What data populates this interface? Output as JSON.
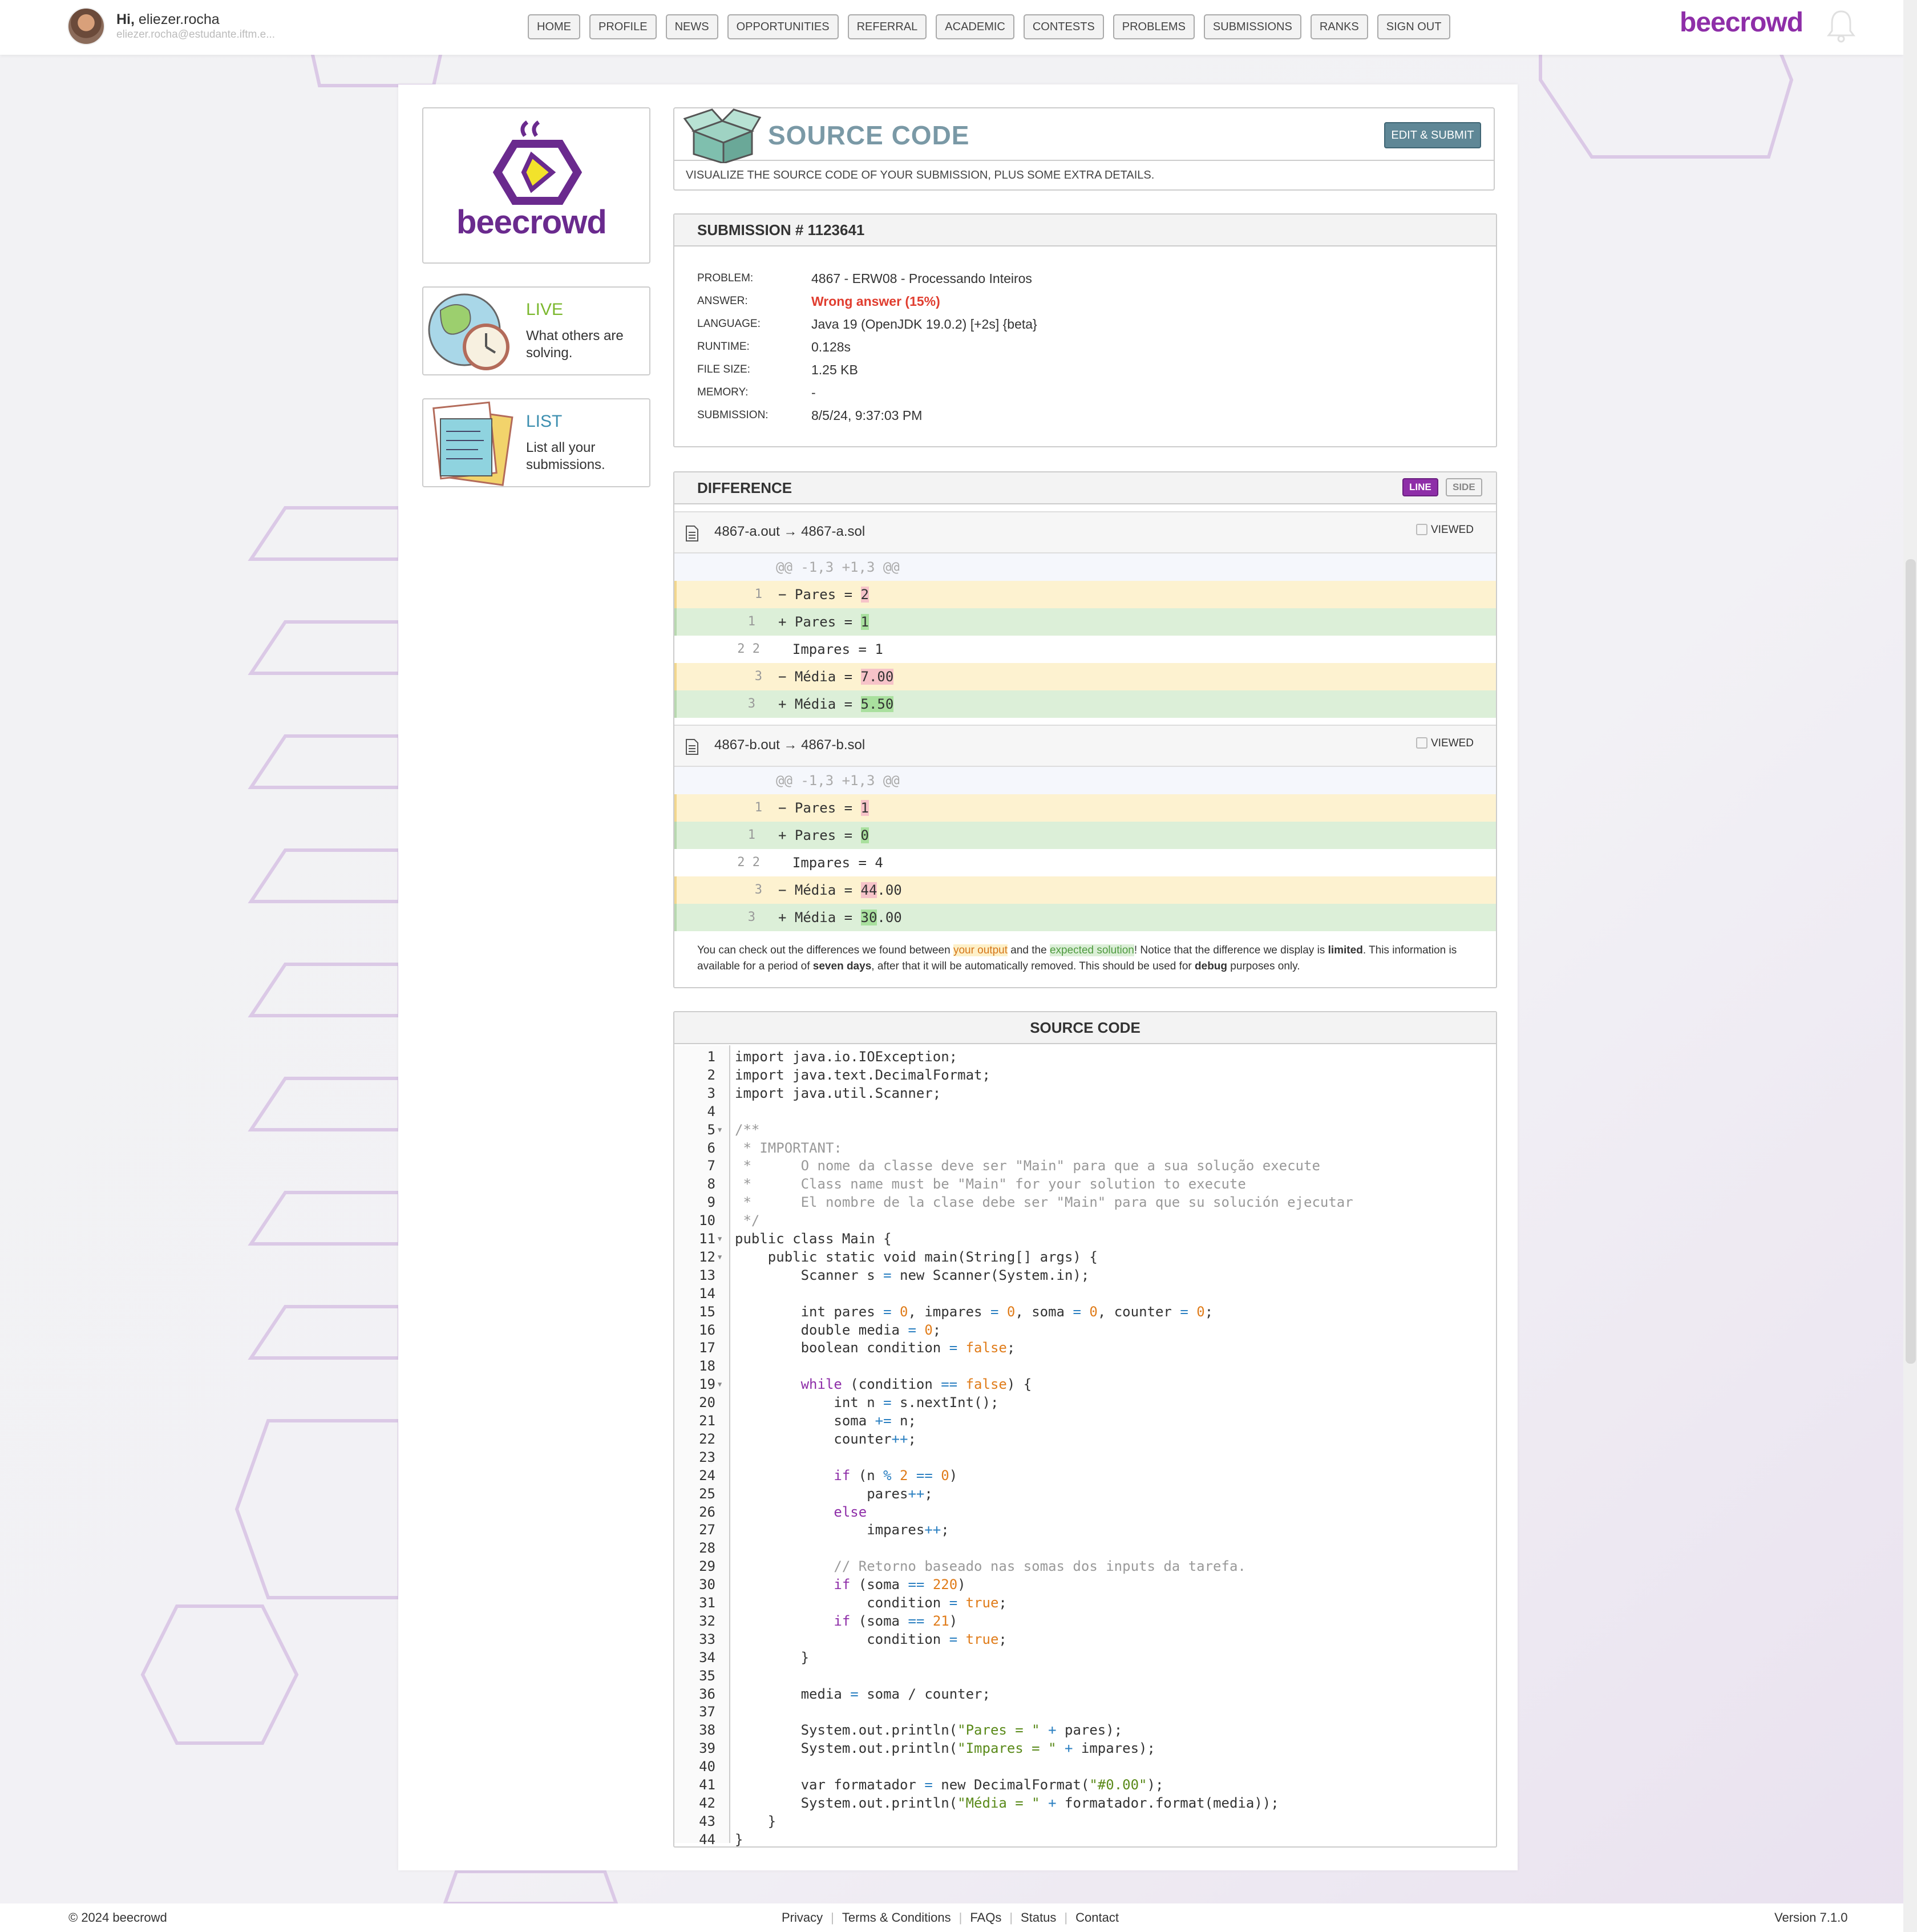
{
  "header": {
    "greeting_prefix": "Hi,",
    "username": "eliezer.rocha",
    "email": "eliezer.rocha@estudante.iftm.e...",
    "brand": "beecrowd",
    "nav": [
      "HOME",
      "PROFILE",
      "NEWS",
      "OPPORTUNITIES",
      "REFERRAL",
      "ACADEMIC",
      "CONTESTS",
      "PROBLEMS",
      "SUBMISSIONS",
      "RANKS",
      "SIGN OUT"
    ]
  },
  "sidebar": {
    "logo_text": "beecrowd",
    "live": {
      "title": "LIVE",
      "desc": "What others are solving."
    },
    "list": {
      "title": "LIST",
      "desc": "List all your submissions."
    }
  },
  "source_header": {
    "title": "SOURCE CODE",
    "edit_button": "EDIT & SUBMIT",
    "subtitle": "VISUALIZE THE SOURCE CODE OF YOUR SUBMISSION, PLUS SOME EXTRA DETAILS."
  },
  "submission": {
    "heading": "SUBMISSION # 1123641",
    "rows": [
      {
        "label": "PROBLEM:",
        "value": "4867 - ERW08 - Processando Inteiros"
      },
      {
        "label": "ANSWER:",
        "value": "Wrong answer (15%)"
      },
      {
        "label": "LANGUAGE:",
        "value": "Java 19 (OpenJDK 19.0.2) [+2s] {beta}"
      },
      {
        "label": "RUNTIME:",
        "value": "0.128s"
      },
      {
        "label": "FILE SIZE:",
        "value": "1.25 KB"
      },
      {
        "label": "MEMORY:",
        "value": "-"
      },
      {
        "label": "SUBMISSION:",
        "value": "8/5/24, 9:37:03 PM"
      }
    ]
  },
  "difference": {
    "heading": "DIFFERENCE",
    "toggle_line": "LINE",
    "toggle_side": "SIDE",
    "viewed_label": "VIEWED",
    "files": [
      {
        "name": "4867-a.out → 4867-a.sol",
        "lines": [
          {
            "kind": "hunk",
            "num": "",
            "text": "@@ -1,3 +1,3 @@"
          },
          {
            "kind": "del",
            "num": "1",
            "pre": "− Pares = ",
            "hl": "2",
            "post": ""
          },
          {
            "kind": "ins",
            "num": "1",
            "pre": "+ Pares = ",
            "hl": "1",
            "post": ""
          },
          {
            "kind": "ctx",
            "num": "2 2",
            "text": "  Impares = 1"
          },
          {
            "kind": "del",
            "num": "3",
            "pre": "− Média = ",
            "hl": "7.00",
            "post": ""
          },
          {
            "kind": "ins",
            "num": "3",
            "pre": "+ Média = ",
            "hl": "5.50",
            "post": ""
          }
        ]
      },
      {
        "name": "4867-b.out → 4867-b.sol",
        "lines": [
          {
            "kind": "hunk",
            "num": "",
            "text": "@@ -1,3 +1,3 @@"
          },
          {
            "kind": "del",
            "num": "1",
            "pre": "− Pares = ",
            "hl": "1",
            "post": ""
          },
          {
            "kind": "ins",
            "num": "1",
            "pre": "+ Pares = ",
            "hl": "0",
            "post": ""
          },
          {
            "kind": "ctx",
            "num": "2 2",
            "text": "  Impares = 4"
          },
          {
            "kind": "del",
            "num": "3",
            "pre": "− Média = ",
            "hl": "44",
            "post": ".00"
          },
          {
            "kind": "ins",
            "num": "3",
            "pre": "+ Média = ",
            "hl": "30",
            "post": ".00"
          }
        ]
      }
    ],
    "note": {
      "p1": "You can check out the differences we found between ",
      "your_output": "your output",
      "p2": " and the ",
      "expected": "expected solution",
      "p3": "! Notice that the difference we display is ",
      "limited": "limited",
      "p4": ". This information is available for a period of ",
      "seven_days": "seven days",
      "p5": ", after that it will be automatically removed. This should be used for ",
      "debug": "debug",
      "p6": " purposes only."
    }
  },
  "source_code": {
    "heading": "SOURCE CODE",
    "fold_lines": [
      5,
      11,
      12,
      19
    ],
    "lines": [
      "import java.io.IOException;",
      "import java.text.DecimalFormat;",
      "import java.util.Scanner;",
      "",
      "/**",
      " * IMPORTANT:",
      " *      O nome da classe deve ser \"Main\" para que a sua solução execute",
      " *      Class name must be \"Main\" for your solution to execute",
      " *      El nombre de la clase debe ser \"Main\" para que su solución ejecutar",
      " */",
      "public class Main {",
      "    public static void main(String[] args) {",
      "        Scanner s = new Scanner(System.in);",
      "",
      "        int pares = 0, impares = 0, soma = 0, counter = 0;",
      "        double media = 0;",
      "        boolean condition = false;",
      "",
      "        while (condition == false) {",
      "            int n = s.nextInt();",
      "            soma += n;",
      "            counter++;",
      "",
      "            if (n % 2 == 0)",
      "                pares++;",
      "            else",
      "                impares++;",
      "",
      "            // Retorno baseado nas somas dos inputs da tarefa.",
      "            if (soma == 220)",
      "                condition = true;",
      "            if (soma == 21)",
      "                condition = true;",
      "        }",
      "",
      "        media = soma / counter;",
      "",
      "        System.out.println(\"Pares = \" + pares);",
      "        System.out.println(\"Impares = \" + impares);",
      "",
      "        var formatador = new DecimalFormat(\"#0.00\");",
      "        System.out.println(\"Média = \" + formatador.format(media));",
      "    }",
      "}"
    ]
  },
  "footer": {
    "copyright": "© 2024 beecrowd",
    "links": [
      "Privacy",
      "Terms & Conditions",
      "FAQs",
      "Status",
      "Contact"
    ],
    "version": "Version 7.1.0"
  },
  "colors": {
    "brand": "#8e2ea8",
    "live": "#7cb82f",
    "list": "#3d8fb0",
    "wrong": "#e03d2f"
  }
}
